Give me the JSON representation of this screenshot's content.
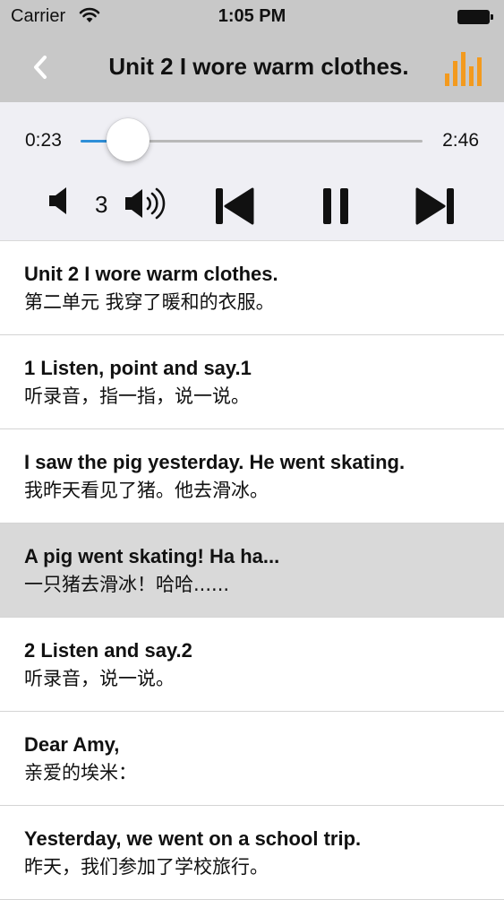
{
  "status_bar": {
    "carrier": "Carrier",
    "time": "1:05 PM"
  },
  "nav": {
    "title": "Unit 2 I wore warm clothes.",
    "back_icon": "chevron-left-icon",
    "equalizer_icon": "equalizer-icon",
    "accent_color": "#f39a1e"
  },
  "player": {
    "current_time": "0:23",
    "total_time": "2:46",
    "progress": 0.14,
    "speed_value": "3",
    "accent_color": "#2e8fd8"
  },
  "sentences": [
    {
      "en": "Unit 2 I wore warm clothes.",
      "zh": "第二单元 我穿了暖和的衣服。",
      "selected": false
    },
    {
      "en": "1 Listen, point and say.1",
      "zh": "听录音，指一指，说一说。",
      "selected": false
    },
    {
      "en": "I saw the pig yesterday. He went skating.",
      "zh": "我昨天看见了猪。他去滑冰。",
      "selected": false
    },
    {
      "en": "A pig went skating! Ha ha...",
      "zh": "一只猪去滑冰！哈哈......",
      "selected": true
    },
    {
      "en": "2 Listen and say.2",
      "zh": "听录音，说一说。",
      "selected": false
    },
    {
      "en": "Dear Amy,",
      "zh": "亲爱的埃米：",
      "selected": false
    },
    {
      "en": "Yesterday, we went on a school trip.",
      "zh": "昨天，我们参加了学校旅行。",
      "selected": false
    }
  ]
}
